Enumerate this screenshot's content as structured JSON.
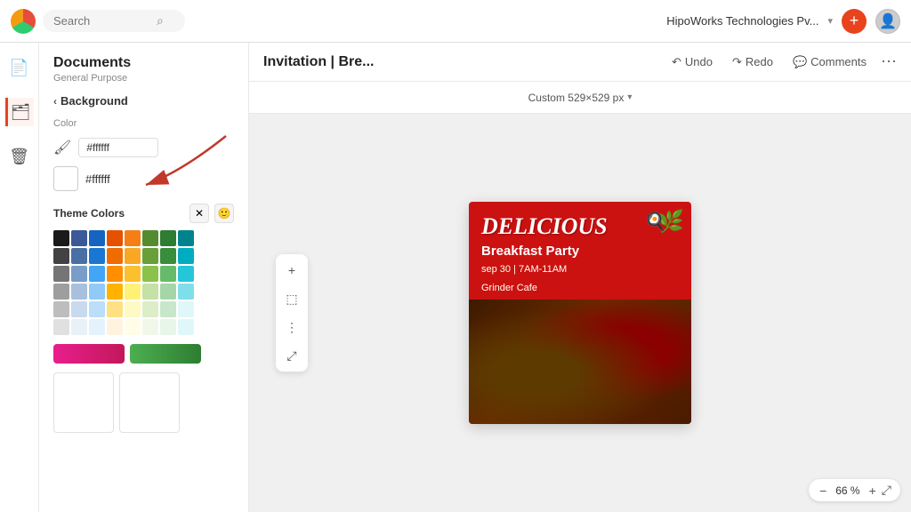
{
  "topbar": {
    "search_placeholder": "Search",
    "company": "HipoWorks Technologies Pv...",
    "undo_label": "Undo",
    "redo_label": "Redo",
    "comments_label": "Comments"
  },
  "sidebar": {
    "title": "Documents",
    "subtitle": "General Purpose",
    "back_label": "Background",
    "color_section_label": "Color",
    "hex_value": "#ffffff",
    "hex_value2": "#ffffff",
    "theme_colors_label": "Theme Colors"
  },
  "canvas": {
    "title": "Invitation | Bre...",
    "size_label": "Custom 529×529 px",
    "zoom_value": "66 %"
  },
  "design": {
    "title": "DELICIOUS",
    "subtitle": "Breakfast Party",
    "line1": "sep 30 | 7AM-11AM",
    "line2": "Grinder Cafe"
  },
  "color_grid": {
    "row1": [
      "#1a1a1a",
      "#3b5998",
      "#1565c0",
      "#e65100",
      "#f57f17",
      "#558b2f",
      "#2e7d32",
      "#00838f"
    ],
    "row2": [
      "#424242",
      "#4a6fa5",
      "#1976d2",
      "#ef6c00",
      "#f9a825",
      "#689f38",
      "#388e3c",
      "#00acc1"
    ],
    "row3": [
      "#757575",
      "#7a9cc9",
      "#42a5f5",
      "#ff8f00",
      "#fbc02d",
      "#8bc34a",
      "#66bb6a",
      "#26c6da"
    ],
    "row4": [
      "#9e9e9e",
      "#a8c0de",
      "#90caf9",
      "#ffb300",
      "#fff176",
      "#c5e1a5",
      "#a5d6a7",
      "#80deea"
    ],
    "row5": [
      "#bdbdbd",
      "#c9d9ee",
      "#bbdefb",
      "#ffe082",
      "#fff9c4",
      "#dcedc8",
      "#c8e6c9",
      "#e0f7fa"
    ],
    "row6": [
      "#e0e0e0",
      "#e8f0f8",
      "#e3f2fd",
      "#fff3e0",
      "#fffde7",
      "#f1f8e9",
      "#e8f5e9",
      "#e0f7fa"
    ]
  }
}
